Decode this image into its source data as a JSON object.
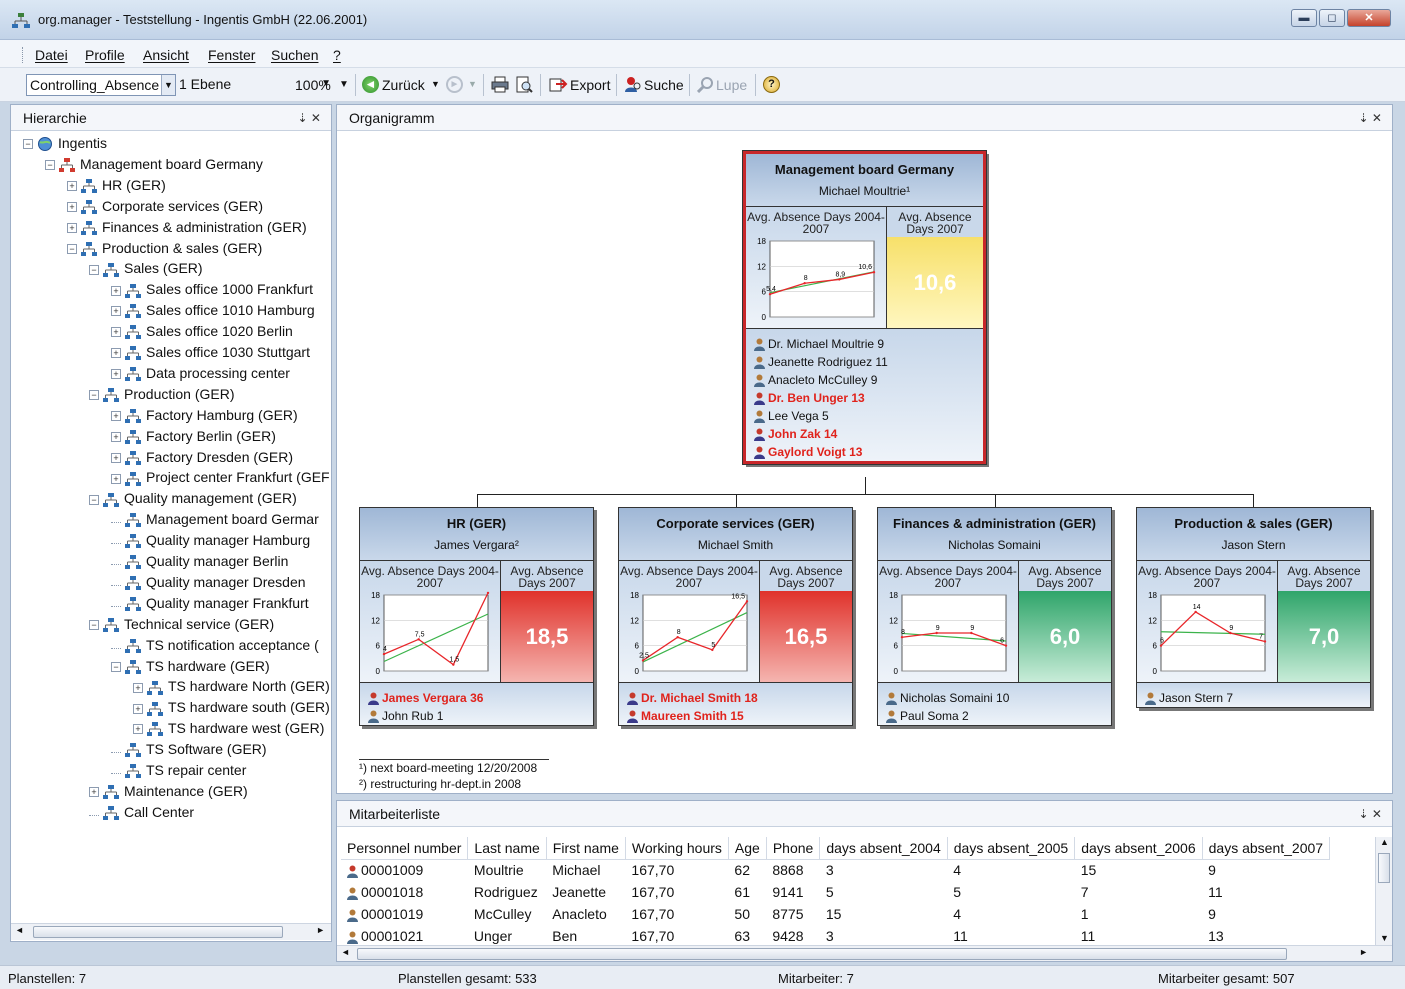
{
  "window": {
    "title": "org.manager - Teststellung - Ingentis GmbH (22.06.2001)",
    "min": "▬",
    "max": "◻",
    "close": "✕"
  },
  "menu": [
    "Datei",
    "Profile",
    "Ansicht",
    "Fenster",
    "Suchen",
    "?"
  ],
  "toolbar": {
    "profile": "Controlling_Absence",
    "level": "1 Ebene",
    "zoom": "100%",
    "back": "Zurück",
    "export": "Export",
    "search": "Suche",
    "zoom_tool": "Lupe"
  },
  "hierarchy": {
    "title": "Hierarchie",
    "pin": "⇣ ✕",
    "items": [
      {
        "label": "Ingentis",
        "exp": "⊟"
      },
      {
        "label": "Management board Germany",
        "exp": "⊟"
      },
      {
        "label": "HR (GER)",
        "exp": "⊞"
      },
      {
        "label": "Corporate services (GER)",
        "exp": "⊞"
      },
      {
        "label": "Finances & administration (GER)",
        "exp": "⊞"
      },
      {
        "label": "Production & sales (GER)",
        "exp": "⊟"
      },
      {
        "label": "Sales (GER)",
        "exp": "⊟"
      },
      {
        "label": "Sales office 1000 Frankfurt",
        "exp": "⊞"
      },
      {
        "label": "Sales office 1010 Hamburg",
        "exp": "⊞"
      },
      {
        "label": "Sales office 1020 Berlin",
        "exp": "⊞"
      },
      {
        "label": "Sales office 1030 Stuttgart",
        "exp": "⊞"
      },
      {
        "label": "Data processing center",
        "exp": "⊞"
      },
      {
        "label": "Production (GER)",
        "exp": "⊟"
      },
      {
        "label": "Factory Hamburg (GER)",
        "exp": "⊞"
      },
      {
        "label": "Factory Berlin (GER)",
        "exp": "⊞"
      },
      {
        "label": "Factory Dresden (GER)",
        "exp": "⊞"
      },
      {
        "label": "Project center Frankfurt (GEF",
        "exp": "⊞"
      },
      {
        "label": "Quality management (GER)",
        "exp": "⊟"
      },
      {
        "label": "Management board Germar",
        "exp": ""
      },
      {
        "label": "Quality manager Hamburg",
        "exp": ""
      },
      {
        "label": "Quality manager Berlin",
        "exp": ""
      },
      {
        "label": "Quality manager Dresden",
        "exp": ""
      },
      {
        "label": "Quality manager Frankfurt",
        "exp": ""
      },
      {
        "label": "Technical service (GER)",
        "exp": "⊟"
      },
      {
        "label": "TS notification acceptance (",
        "exp": ""
      },
      {
        "label": "TS hardware (GER)",
        "exp": "⊟"
      },
      {
        "label": "TS hardware North (GER)",
        "exp": "⊞"
      },
      {
        "label": "TS hardware south (GER)",
        "exp": "⊞"
      },
      {
        "label": "TS hardware west (GER)",
        "exp": "⊞"
      },
      {
        "label": "TS Software (GER)",
        "exp": ""
      },
      {
        "label": "TS repair center",
        "exp": ""
      },
      {
        "label": "Maintenance (GER)",
        "exp": "⊞"
      },
      {
        "label": "Call Center",
        "exp": ""
      }
    ]
  },
  "orgchart": {
    "title": "Organigramm",
    "pin": "⇣ ✕",
    "chart_label": "Avg. Absence Days 2004-2007",
    "value_label": "Avg. Absence Days 2007",
    "footnotes": [
      "¹) next board-meeting 12/20/2008",
      "²) restructuring hr-dept.in 2008"
    ],
    "top": {
      "title": "Management board Germany",
      "manager": "Michael Moultrie¹",
      "value": "10,6",
      "color": "#f2c94c",
      "members": [
        {
          "name": "Dr. Michael Moultrie 9",
          "red": false
        },
        {
          "name": "Jeanette Rodriguez 11",
          "red": false
        },
        {
          "name": "Anacleto McCulley 9",
          "red": false
        },
        {
          "name": "Dr. Ben Unger 13",
          "red": true
        },
        {
          "name": "Lee Vega 5",
          "red": false
        },
        {
          "name": "John Zak 14",
          "red": true
        },
        {
          "name": "Gaylord Voigt 13",
          "red": true
        }
      ]
    },
    "children": [
      {
        "title": "HR (GER)",
        "manager": "James Vergara²",
        "value": "18,5",
        "color": "#e03a35",
        "members": [
          {
            "name": "James Vergara 36",
            "red": true
          },
          {
            "name": "John Rub 1",
            "red": false
          }
        ]
      },
      {
        "title": "Corporate services (GER)",
        "manager": "Michael Smith",
        "value": "16,5",
        "color": "#e03a35",
        "members": [
          {
            "name": "Dr. Michael Smith 18",
            "red": true
          },
          {
            "name": "Maureen Smith 15",
            "red": true
          }
        ]
      },
      {
        "title": "Finances & administration (GER)",
        "manager": "Nicholas Somaini",
        "value": "6,0",
        "color": "#3fae78",
        "members": [
          {
            "name": "Nicholas Somaini 10",
            "red": false
          },
          {
            "name": "Paul Soma 2",
            "red": false
          }
        ]
      },
      {
        "title": "Production & sales (GER)",
        "manager": "Jason Stern",
        "value": "7,0",
        "color": "#3fae78",
        "members": [
          {
            "name": "Jason Stern 7",
            "red": false
          }
        ]
      }
    ]
  },
  "chart_data": [
    {
      "type": "line",
      "title": "Management board Germany",
      "x": [
        2004,
        2005,
        2006,
        2007
      ],
      "values": [
        5.4,
        8,
        8.9,
        10.6
      ],
      "yticks": [
        "0",
        "6",
        "12",
        "18"
      ],
      "ylim": [
        0,
        18
      ],
      "labels": [
        "5,4",
        "8",
        "8,9",
        "10,6"
      ]
    },
    {
      "type": "line",
      "title": "HR (GER)",
      "x": [
        2004,
        2005,
        2006,
        2007
      ],
      "values": [
        4,
        7.5,
        1.5,
        18.5
      ],
      "yticks": [
        "0",
        "6",
        "12",
        "18"
      ],
      "ylim": [
        0,
        18
      ],
      "labels": [
        "4",
        "7,5",
        "1,5",
        "18,5"
      ]
    },
    {
      "type": "line",
      "title": "Corporate services (GER)",
      "x": [
        2004,
        2005,
        2006,
        2007
      ],
      "values": [
        2.5,
        8,
        5,
        16.5
      ],
      "yticks": [
        "0",
        "6",
        "12",
        "18"
      ],
      "ylim": [
        0,
        18
      ],
      "labels": [
        "2,5",
        "8",
        "5",
        "16,5"
      ]
    },
    {
      "type": "line",
      "title": "Finances & administration (GER)",
      "x": [
        2004,
        2005,
        2006,
        2007
      ],
      "values": [
        8,
        9,
        9,
        6
      ],
      "yticks": [
        "0",
        "6",
        "12",
        "18"
      ],
      "ylim": [
        0,
        18
      ],
      "labels": [
        "8",
        "9",
        "9",
        "6"
      ]
    },
    {
      "type": "line",
      "title": "Production & sales (GER)",
      "x": [
        2004,
        2005,
        2006,
        2007
      ],
      "values": [
        6,
        14,
        9,
        7
      ],
      "yticks": [
        "0",
        "6",
        "12",
        "18"
      ],
      "ylim": [
        0,
        18
      ],
      "labels": [
        "6",
        "14",
        "9",
        "7"
      ]
    }
  ],
  "employees": {
    "title": "Mitarbeiterliste",
    "pin": "⇣ ✕",
    "columns": [
      "Personnel number",
      "Last name",
      "First name",
      "Working hours",
      "Age",
      "Phone",
      "days absent_2004",
      "days absent_2005",
      "days absent_2006",
      "days absent_2007"
    ],
    "rows": [
      [
        "00001009",
        "Moultrie",
        "Michael",
        "167,70",
        "62",
        "8868",
        "3",
        "4",
        "15",
        "9"
      ],
      [
        "00001018",
        "Rodriguez",
        "Jeanette",
        "167,70",
        "61",
        "9141",
        "5",
        "5",
        "7",
        "11"
      ],
      [
        "00001019",
        "McCulley",
        "Anacleto",
        "167,70",
        "50",
        "8775",
        "15",
        "4",
        "1",
        "9"
      ],
      [
        "00001021",
        "Unger",
        "Ben",
        "167,70",
        "63",
        "9428",
        "3",
        "11",
        "11",
        "13"
      ]
    ]
  },
  "status": {
    "planstellen": "Planstellen: 7",
    "planstellen_gesamt": "Planstellen gesamt: 533",
    "mitarbeiter": "Mitarbeiter: 7",
    "mitarbeiter_gesamt": "Mitarbeiter gesamt: 507"
  }
}
